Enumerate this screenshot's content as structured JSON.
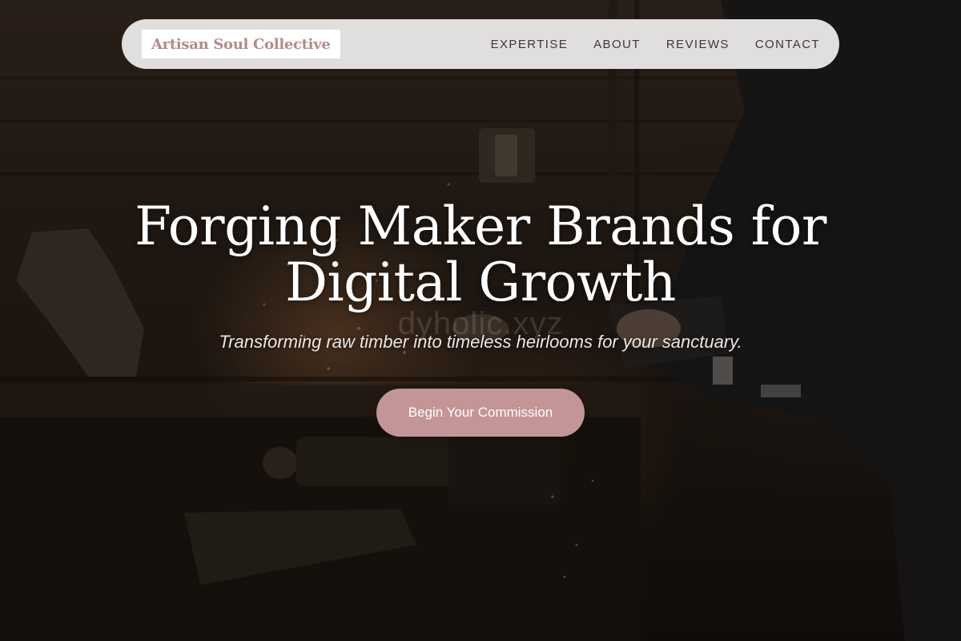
{
  "brand": {
    "name": "Artisan Soul Collective",
    "accent_color": "#c39597",
    "logo_text_color": "#b58a8c"
  },
  "nav": {
    "items": [
      {
        "label": "EXPERTISE"
      },
      {
        "label": "ABOUT"
      },
      {
        "label": "REVIEWS"
      },
      {
        "label": "CONTACT"
      }
    ]
  },
  "hero": {
    "title_line1": "Forging Maker Brands for",
    "title_line2": "Digital Growth",
    "subtitle": "Transforming raw timber into timeless heirlooms for your sanctuary.",
    "cta_label": "Begin Your Commission",
    "background_image": "woodworker-workshop-photo",
    "watermark": "dyholic.xyz"
  }
}
